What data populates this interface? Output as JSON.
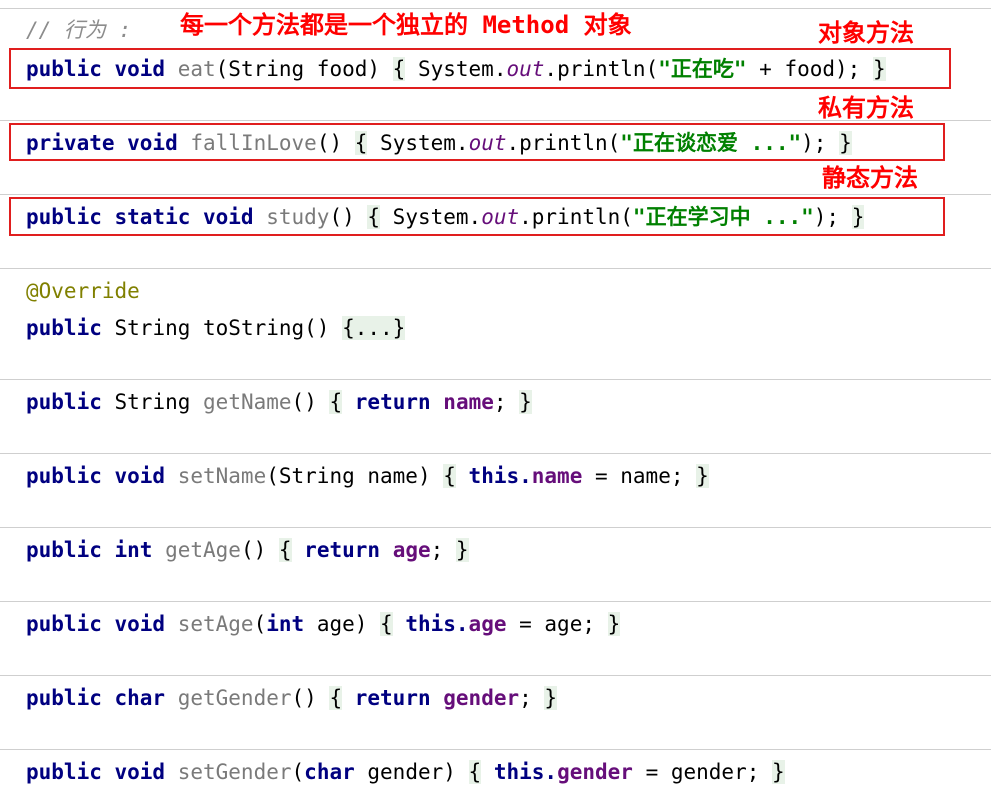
{
  "comment": "// 行为 :",
  "heading_note": "每一个方法都是一个独立的 Method 对象",
  "labels": {
    "object_method": "对象方法",
    "private_method": "私有方法",
    "static_method": "静态方法"
  },
  "colors": {
    "keyword": "#000080",
    "string": "#008000",
    "field": "#660e7a",
    "annotation": "#808000",
    "method_name": "#7a7a7a",
    "highlight_box": "#e01e1e",
    "fold_bg": "#e8f2e8"
  },
  "code": {
    "eat": {
      "mod": "public void ",
      "name": "eat",
      "params": "(String food) ",
      "open": "{",
      "body1": " System.",
      "out": "out",
      "body2": ".println(",
      "str": "\"正在吃\"",
      "body3": " + food); ",
      "close": "}"
    },
    "fall": {
      "mod": "private void ",
      "name": "fallInLove",
      "params": "() ",
      "open": "{",
      "body1": " System.",
      "out": "out",
      "body2": ".println(",
      "str": "\"正在谈恋爱 ...\"",
      "body3": "); ",
      "close": "}"
    },
    "study": {
      "mod": "public static void ",
      "name": "study",
      "params": "() ",
      "open": "{",
      "body1": " System.",
      "out": "out",
      "body2": ".println(",
      "str": "\"正在学习中 ...\"",
      "body3": "); ",
      "close": "}"
    },
    "override": "@Override",
    "tostring": {
      "mod": "public ",
      "type": "String toString() ",
      "fold": "{...}"
    },
    "getname": {
      "mod": "public ",
      "type": "String ",
      "name": "getName",
      "params": "() ",
      "open": "{",
      "ret": " return ",
      "field": "name",
      "end": "; ",
      "close": "}"
    },
    "setname": {
      "mod": "public void ",
      "name": "setName",
      "params": "(String name) ",
      "open": "{",
      "this": " this.",
      "field": "name",
      "rest": " = name; ",
      "close": "}"
    },
    "getage": {
      "mod": "public int ",
      "name": "getAge",
      "params": "() ",
      "open": "{",
      "ret": " return ",
      "field": "age",
      "end": "; ",
      "close": "}"
    },
    "setage": {
      "mod": "public void ",
      "name": "setAge",
      "p1": "(",
      "ptype": "int",
      "p2": " age) ",
      "open": "{",
      "this": " this.",
      "field": "age",
      "rest": " = age; ",
      "close": "}"
    },
    "getgender": {
      "mod": "public char ",
      "name": "getGender",
      "params": "() ",
      "open": "{",
      "ret": " return ",
      "field": "gender",
      "end": "; ",
      "close": "}"
    },
    "setgender": {
      "mod": "public void ",
      "name": "setGender",
      "p1": "(",
      "ptype": "char",
      "p2": " gender) ",
      "open": "{",
      "this": " this.",
      "field": "gender",
      "rest": " = gender; ",
      "close": "}"
    }
  }
}
